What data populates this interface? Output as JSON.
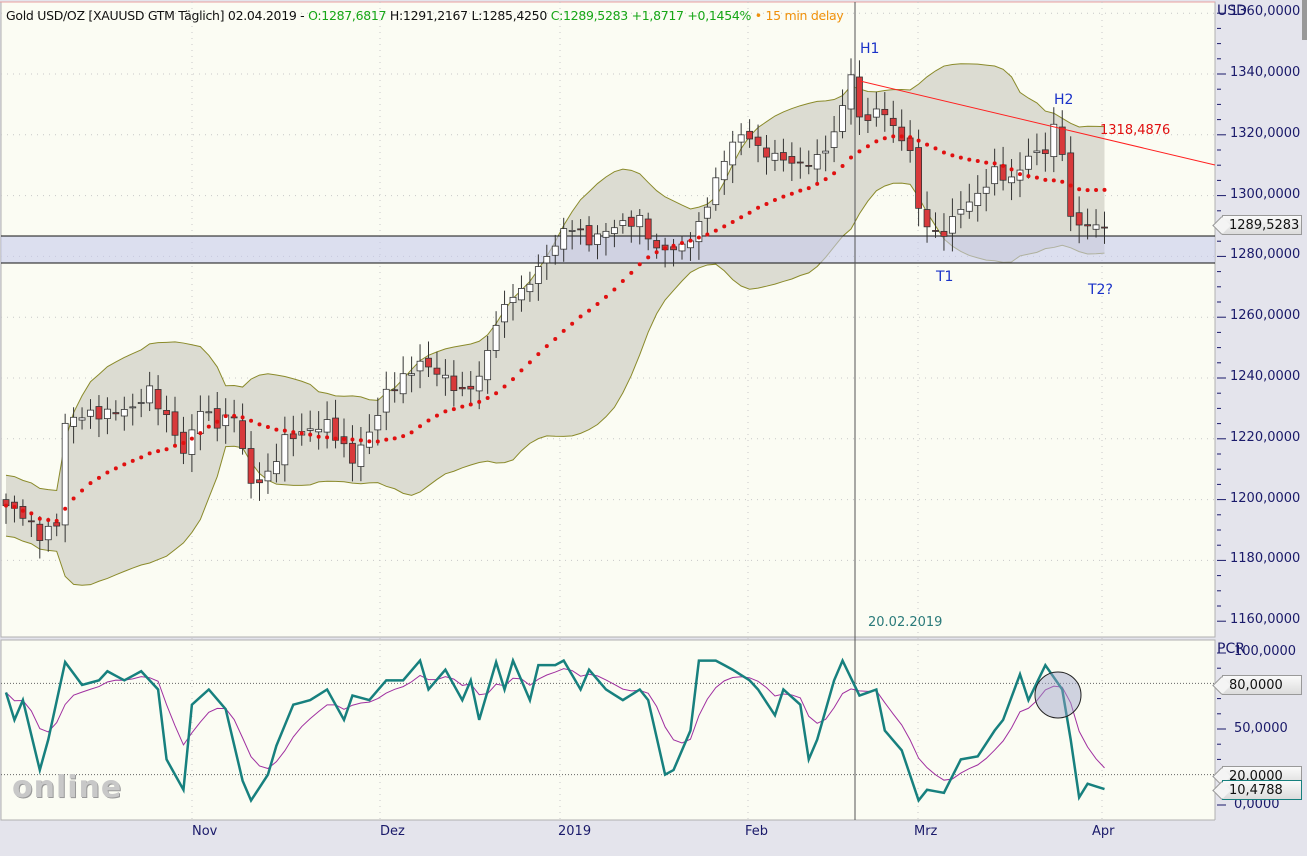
{
  "header": {
    "instrument": "Gold USD/OZ [XAUUSD GTM Täglich] 02.04.2019 -",
    "open": "O:1287,6817",
    "high": "H:1291,2167",
    "low": "L:1285,4250",
    "close": "C:1289,5283 +1,8717 +0,1454%",
    "delay": "• 15 min delay"
  },
  "price_axis": {
    "unit": "USD",
    "ticks": [
      "1360,0000",
      "1340,0000",
      "1320,0000",
      "1300,0000",
      "1280,0000",
      "1260,0000",
      "1240,0000",
      "1220,0000",
      "1200,0000",
      "1180,0000",
      "1160,0000"
    ],
    "current_tag": "1289,5283"
  },
  "pcr_axis": {
    "unit": "PCR",
    "ticks": [
      "100,0000",
      "50,0000",
      "0,0000"
    ],
    "tag_80": "80,0000",
    "tag_20": "20,0000",
    "current_tag": "10,4788"
  },
  "annotations": {
    "h1": "H1",
    "h2": "H2",
    "t1": "T1",
    "t2": "T2?",
    "trendline_value": "1318,4876",
    "crosshair_date": "20.02.2019"
  },
  "x_axis": {
    "months": [
      "Nov",
      "Dez",
      "2019",
      "Feb",
      "Mrz",
      "Apr"
    ]
  },
  "watermark": "online",
  "colors": {
    "up": "#ffffff",
    "down": "#d8393b",
    "sma": "#e01010",
    "band": "#8a8a2a",
    "pcr": "#17807e",
    "pcr_signal": "#a030a0",
    "trend": "#ff2020"
  },
  "chart_data": {
    "type": "candlestick",
    "title": "Gold USD/OZ daily",
    "ylim": [
      1160,
      1360
    ],
    "support_zone": [
      1277,
      1286
    ],
    "trendline": {
      "from": [
        1340,
        "20.02.2019"
      ],
      "value_end": 1318.4876
    },
    "close_keypoints": [
      [
        0,
        1198
      ],
      [
        2,
        1195
      ],
      [
        4,
        1188
      ],
      [
        6,
        1192
      ],
      [
        7,
        1225
      ],
      [
        9,
        1228
      ],
      [
        11,
        1228
      ],
      [
        15,
        1230
      ],
      [
        17,
        1236
      ],
      [
        20,
        1222
      ],
      [
        21,
        1215
      ],
      [
        23,
        1230
      ],
      [
        25,
        1225
      ],
      [
        27,
        1228
      ],
      [
        29,
        1205
      ],
      [
        31,
        1208
      ],
      [
        33,
        1220
      ],
      [
        35,
        1222
      ],
      [
        38,
        1225
      ],
      [
        41,
        1213
      ],
      [
        43,
        1222
      ],
      [
        45,
        1235
      ],
      [
        47,
        1240
      ],
      [
        49,
        1245
      ],
      [
        51,
        1242
      ],
      [
        54,
        1235
      ],
      [
        56,
        1240
      ],
      [
        58,
        1258
      ],
      [
        60,
        1268
      ],
      [
        61,
        1268
      ],
      [
        64,
        1280
      ],
      [
        66,
        1288
      ],
      [
        67,
        1290
      ],
      [
        69,
        1285
      ],
      [
        72,
        1290
      ],
      [
        75,
        1292
      ],
      [
        77,
        1282
      ],
      [
        80,
        1283
      ],
      [
        82,
        1290
      ],
      [
        84,
        1305
      ],
      [
        86,
        1318
      ],
      [
        88,
        1320
      ],
      [
        89,
        1315
      ],
      [
        92,
        1312
      ],
      [
        94,
        1310
      ],
      [
        96,
        1312
      ],
      [
        98,
        1320
      ],
      [
        100,
        1340
      ],
      [
        101,
        1325
      ],
      [
        104,
        1328
      ],
      [
        105,
        1322
      ],
      [
        107,
        1315
      ],
      [
        108,
        1295
      ],
      [
        110,
        1287
      ],
      [
        111,
        1288
      ],
      [
        113,
        1296
      ],
      [
        115,
        1300
      ],
      [
        117,
        1308
      ],
      [
        119,
        1305
      ],
      [
        121,
        1313
      ],
      [
        123,
        1315
      ],
      [
        124,
        1322
      ],
      [
        125,
        1315
      ],
      [
        126,
        1292
      ],
      [
        128,
        1290
      ],
      [
        130,
        1289.5283
      ]
    ],
    "pcr_keypoints": [
      [
        0,
        74
      ],
      [
        1,
        56
      ],
      [
        2,
        69
      ],
      [
        4,
        23
      ],
      [
        5,
        43
      ],
      [
        7,
        94
      ],
      [
        9,
        79
      ],
      [
        11,
        82
      ],
      [
        12,
        88
      ],
      [
        14,
        82
      ],
      [
        16,
        88
      ],
      [
        18,
        76
      ],
      [
        19,
        30
      ],
      [
        21,
        10
      ],
      [
        22,
        66
      ],
      [
        24,
        76
      ],
      [
        26,
        63
      ],
      [
        28,
        16
      ],
      [
        29,
        3
      ],
      [
        31,
        20
      ],
      [
        32,
        39
      ],
      [
        34,
        66
      ],
      [
        36,
        69
      ],
      [
        38,
        76
      ],
      [
        40,
        56
      ],
      [
        41,
        72
      ],
      [
        43,
        69
      ],
      [
        45,
        82
      ],
      [
        47,
        82
      ],
      [
        49,
        95
      ],
      [
        50,
        76
      ],
      [
        52,
        89
      ],
      [
        54,
        69
      ],
      [
        55,
        82
      ],
      [
        56,
        56
      ],
      [
        58,
        94
      ],
      [
        59,
        76
      ],
      [
        60,
        95
      ],
      [
        62,
        69
      ],
      [
        63,
        92
      ],
      [
        65,
        92
      ],
      [
        66,
        95
      ],
      [
        68,
        76
      ],
      [
        69,
        89
      ],
      [
        71,
        76
      ],
      [
        73,
        69
      ],
      [
        75,
        76
      ],
      [
        76,
        69
      ],
      [
        78,
        20
      ],
      [
        79,
        23
      ],
      [
        81,
        49
      ],
      [
        82,
        95
      ],
      [
        84,
        95
      ],
      [
        86,
        89
      ],
      [
        88,
        82
      ],
      [
        89,
        76
      ],
      [
        91,
        59
      ],
      [
        92,
        76
      ],
      [
        94,
        66
      ],
      [
        95,
        30
      ],
      [
        96,
        43
      ],
      [
        98,
        82
      ],
      [
        99,
        95
      ],
      [
        101,
        72
      ],
      [
        103,
        76
      ],
      [
        104,
        49
      ],
      [
        106,
        36
      ],
      [
        108,
        3
      ],
      [
        109,
        10
      ],
      [
        111,
        8
      ],
      [
        113,
        30
      ],
      [
        115,
        32
      ],
      [
        117,
        49
      ],
      [
        118,
        56
      ],
      [
        120,
        86
      ],
      [
        121,
        69
      ],
      [
        123,
        92
      ],
      [
        125,
        76
      ],
      [
        126,
        43
      ],
      [
        127,
        5
      ],
      [
        128,
        14
      ],
      [
        130,
        10.4788
      ]
    ],
    "pcr_levels": [
      80,
      20
    ],
    "pcr_ylim": [
      0,
      100
    ]
  }
}
